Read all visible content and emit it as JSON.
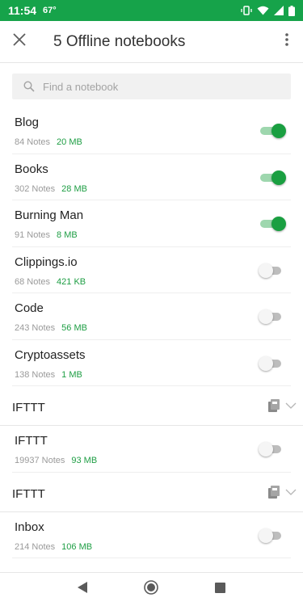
{
  "status_bar": {
    "time": "11:54",
    "temperature": "67°",
    "background_color": "#16a34a"
  },
  "toolbar": {
    "title": "5 Offline notebooks",
    "close_icon": "close-icon",
    "more_icon": "more-vert-icon"
  },
  "search": {
    "placeholder": "Find a notebook"
  },
  "notebooks": [
    {
      "name": "Blog",
      "notes": "84 Notes",
      "size": "20 MB",
      "offline": true
    },
    {
      "name": "Books",
      "notes": "302 Notes",
      "size": "28 MB",
      "offline": true
    },
    {
      "name": "Burning Man",
      "notes": "91 Notes",
      "size": "8 MB",
      "offline": true
    },
    {
      "name": "Clippings.io",
      "notes": "68 Notes",
      "size": "421 KB",
      "offline": false
    },
    {
      "name": "Code",
      "notes": "243 Notes",
      "size": "56 MB",
      "offline": false
    },
    {
      "name": "Cryptoassets",
      "notes": "138 Notes",
      "size": "1 MB",
      "offline": false
    }
  ],
  "stack_1": {
    "name": "IFTTT",
    "notebooks": [
      {
        "name": "IFTTT",
        "notes": "19937 Notes",
        "size": "93 MB",
        "offline": false
      }
    ]
  },
  "stack_2": {
    "name": "IFTTT",
    "notebooks": [
      {
        "name": "Inbox",
        "notes": "214 Notes",
        "size": "106 MB",
        "offline": false
      }
    ]
  },
  "colors": {
    "accent_green": "#1a9f41",
    "size_green": "#1e9e44",
    "muted_text": "#9a9a9a"
  }
}
